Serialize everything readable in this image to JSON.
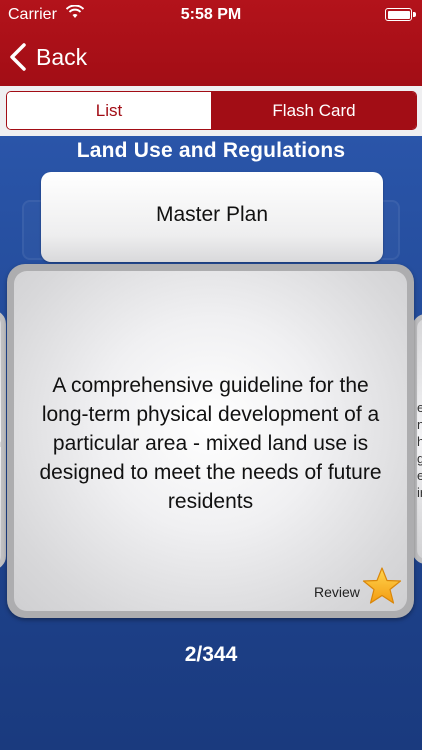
{
  "status": {
    "carrier": "Carrier",
    "time": "5:58 PM"
  },
  "nav": {
    "back_label": "Back"
  },
  "segments": {
    "list": "List",
    "flash_card": "Flash Card"
  },
  "deck": {
    "title": "Land Use and Regulations",
    "term": "Master Plan",
    "definition": "A comprehensive guideline for the long-term physical development of a particular area - mixed land use is designed to meet the needs of future residents",
    "review_label": "Review",
    "counter": "2/344"
  },
  "colors": {
    "brand_red": "#a20d15",
    "background_blue": "#1f4590",
    "star": "#f5a623"
  }
}
